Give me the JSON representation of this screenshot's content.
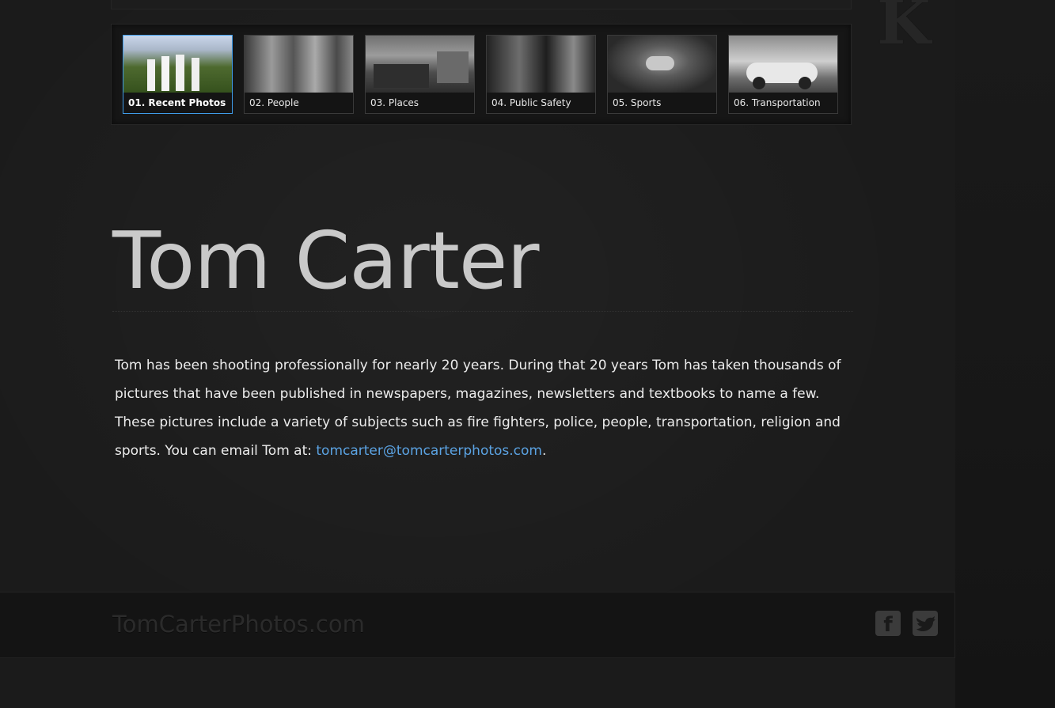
{
  "site": {
    "corner_logo_glyph": "K"
  },
  "gallery": {
    "categories": [
      {
        "label": "01. Recent Photos",
        "photo": "recent-photos-thumbnail",
        "active": true
      },
      {
        "label": "02. People",
        "photo": "people-thumbnail",
        "active": false
      },
      {
        "label": "03. Places",
        "photo": "places-thumbnail",
        "active": false
      },
      {
        "label": "04. Public Safety",
        "photo": "public-safety-thumbnail",
        "active": false
      },
      {
        "label": "05. Sports",
        "photo": "sports-thumbnail",
        "active": false
      },
      {
        "label": "06. Transportation",
        "photo": "transportation-thumbnail",
        "active": false
      }
    ]
  },
  "main": {
    "title": "Tom Carter",
    "bio_text": "Tom has been shooting professionally for nearly 20 years. During that 20 years Tom has taken thousands of pictures that have been published in newspapers, magazines, newsletters and textbooks to name a few. These pictures include a variety of subjects such as fire fighters, police, people, transportation, religion and sports. You can email Tom at: ",
    "email_link": "tomcarter@tomcarterphotos.com",
    "bio_end": "."
  },
  "footer": {
    "brand": "TomCarterPhotos.com",
    "facebook_glyph": "f",
    "social": [
      "facebook-icon",
      "twitter-icon"
    ]
  },
  "colors": {
    "background": "#1b1b1b",
    "active_border": "#3f9be8",
    "link": "#5ba3e3",
    "title": "#c9c9c9"
  }
}
